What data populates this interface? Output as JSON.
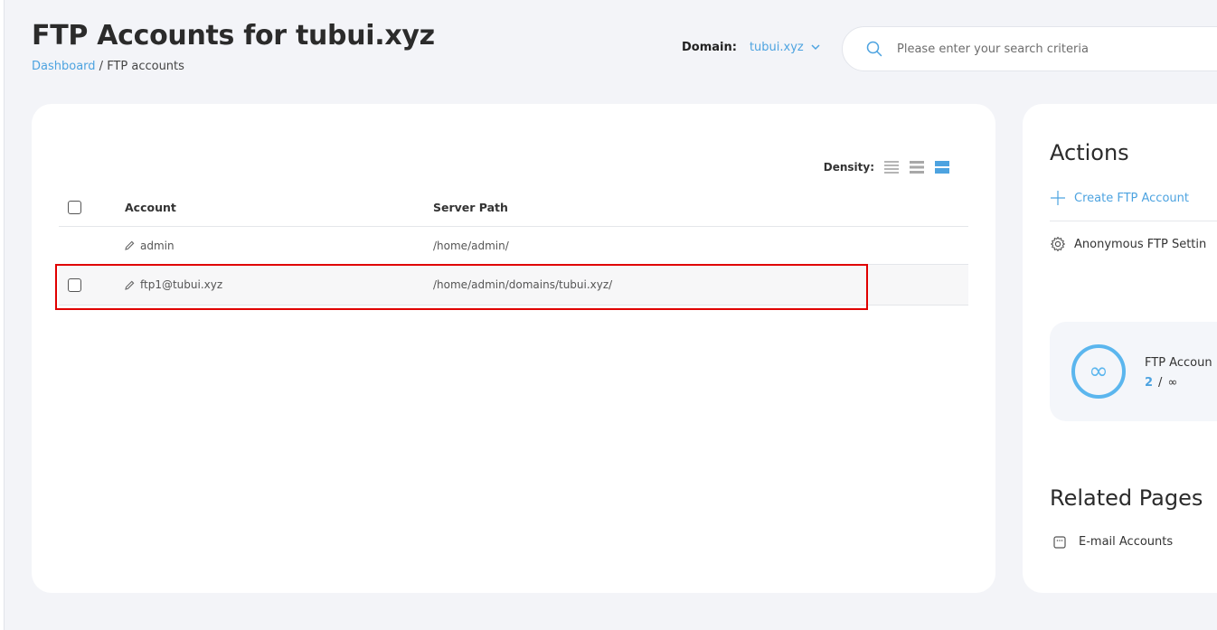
{
  "header": {
    "title": "FTP Accounts for tubui.xyz",
    "breadcrumb": {
      "home": "Dashboard",
      "separator": " / ",
      "current": "FTP accounts"
    },
    "domain": {
      "label": "Domain:",
      "value": "tubui.xyz"
    },
    "search": {
      "placeholder": "Please enter your search criteria",
      "value": ""
    }
  },
  "table": {
    "density_label": "Density:",
    "columns": {
      "account": "Account",
      "server_path": "Server Path"
    },
    "rows": [
      {
        "account": "admin",
        "path": "/home/admin/"
      },
      {
        "account": "ftp1@tubui.xyz",
        "path": "/home/admin/domains/tubui.xyz/"
      }
    ]
  },
  "actions": {
    "title": "Actions",
    "create": "Create FTP Account",
    "anonymous": "Anonymous FTP Settin"
  },
  "stats": {
    "label": "FTP Accoun",
    "used": "2",
    "separator": "/",
    "max": "∞",
    "ring_symbol": "∞"
  },
  "related": {
    "title": "Related Pages",
    "items": [
      {
        "label": "E-mail Accounts"
      }
    ]
  },
  "colors": {
    "accent": "#4da3e0",
    "highlight": "#e00000",
    "background": "#f3f4f8"
  }
}
